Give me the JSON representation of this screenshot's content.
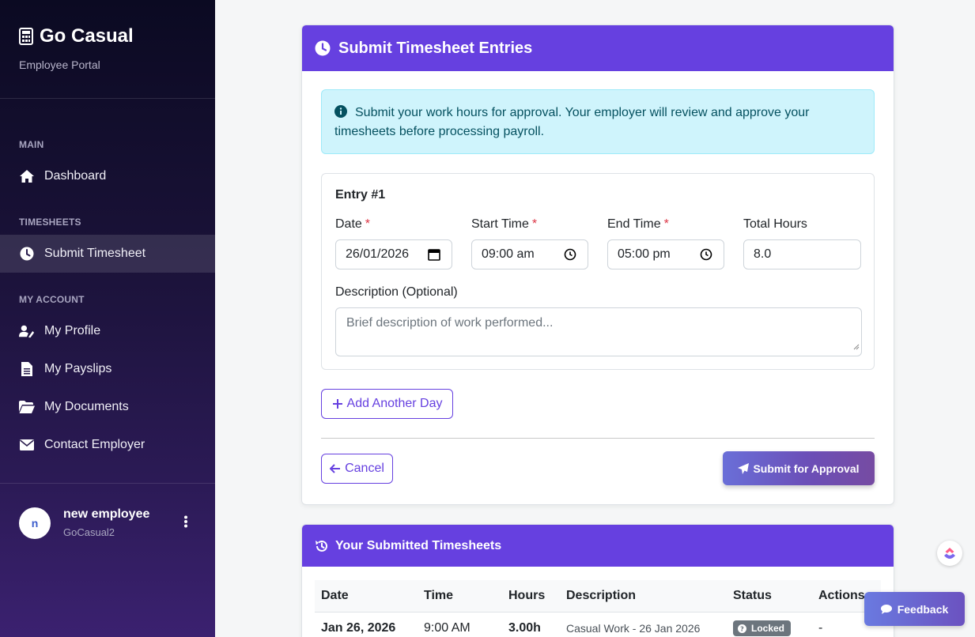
{
  "sidebar": {
    "brand": "Go Casual",
    "brand_sub": "Employee Portal",
    "sections": {
      "main": "MAIN",
      "timesheets": "TIMESHEETS",
      "account": "MY ACCOUNT"
    },
    "items": [
      {
        "label": "Dashboard",
        "icon": "home-icon"
      },
      {
        "label": "Submit Timesheet",
        "icon": "clock-icon",
        "active": true
      },
      {
        "label": "My Profile",
        "icon": "user-edit-icon"
      },
      {
        "label": "My Payslips",
        "icon": "file-icon"
      },
      {
        "label": "My Documents",
        "icon": "folder-icon"
      },
      {
        "label": "Contact Employer",
        "icon": "envelope-icon"
      }
    ],
    "user": {
      "initial": "n",
      "name": "new employee",
      "company": "GoCasual2"
    }
  },
  "form": {
    "title": "Submit Timesheet Entries",
    "alert": "Submit your work hours for approval. Your employer will review and approve your timesheets before processing payroll.",
    "entry": {
      "title": "Entry #1",
      "date_label": "Date",
      "date_value": "26/01/2026",
      "start_label": "Start Time",
      "start_value": "09:00 am",
      "end_label": "End Time",
      "end_value": "05:00 pm",
      "total_label": "Total Hours",
      "total_value": "8.0",
      "required_mark": "*",
      "desc_label": "Description (Optional)",
      "desc_placeholder": "Brief description of work performed..."
    },
    "add_label": "Add Another Day",
    "cancel_label": "Cancel",
    "submit_label": "Submit for Approval"
  },
  "submitted": {
    "title": "Your Submitted Timesheets",
    "columns": [
      "Date",
      "Time",
      "Hours",
      "Description",
      "Status",
      "Actions"
    ],
    "rows": [
      {
        "date": "Jan 26, 2026",
        "time": "9:00 AM",
        "hours": "3.00h",
        "description": "Casual Work - 26 Jan 2026",
        "status": "Locked",
        "actions": "-"
      }
    ]
  },
  "feedback_label": "Feedback",
  "colors": {
    "accent": "#6640e0",
    "info_bg": "#cff4fc",
    "badge": "#6c757d"
  }
}
